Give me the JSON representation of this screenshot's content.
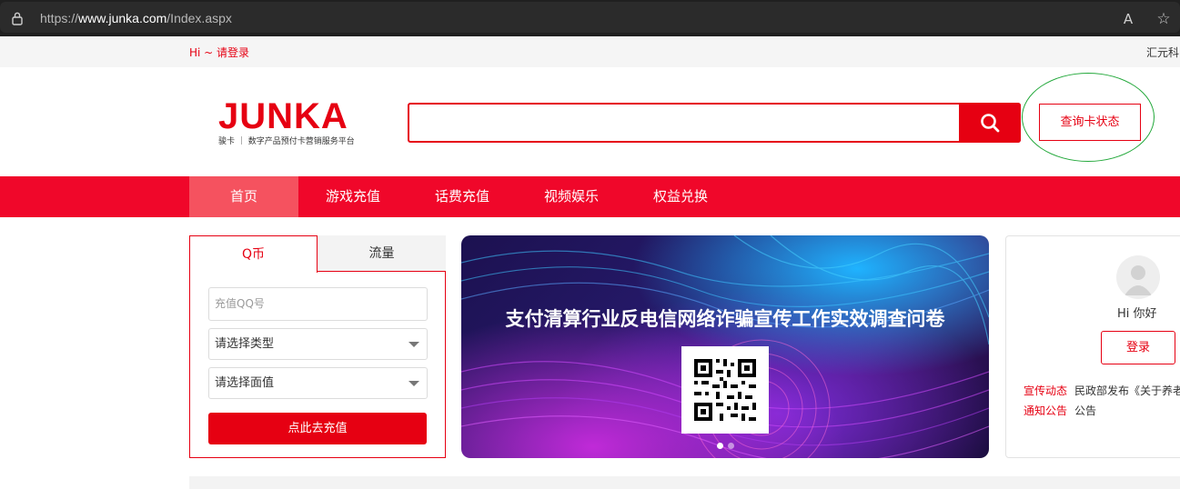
{
  "browser": {
    "url_prefix": "https://",
    "url_domain": "www.junka.com",
    "url_path": "/Index.aspx",
    "read_aloud_icon": "A",
    "favorite_icon": "☆"
  },
  "topbar": {
    "greeting": "Hi ~ 请登录",
    "right_text": "汇元科"
  },
  "header": {
    "logo_word": "JUNKA",
    "logo_tagline": "骏卡 ｜ 数字产品预付卡营销服务平台",
    "search_placeholder": "",
    "query_button": "查询卡状态"
  },
  "nav": {
    "items": [
      {
        "label": "首页"
      },
      {
        "label": "游戏充值"
      },
      {
        "label": "话费充值"
      },
      {
        "label": "视频娱乐"
      },
      {
        "label": "权益兑换"
      }
    ]
  },
  "recharge": {
    "tabs": [
      {
        "label": "Q币"
      },
      {
        "label": "流量"
      }
    ],
    "qq_placeholder": "充值QQ号",
    "type_select": "请选择类型",
    "value_select": "请选择面值",
    "submit": "点此去充值"
  },
  "banner": {
    "title": "支付清算行业反电信网络诈骗宣传工作实效调查问卷"
  },
  "user": {
    "hello": "Hi 你好",
    "login": "登录",
    "news": [
      {
        "tag": "宣传动态",
        "text": "民政部发布《关于养老"
      },
      {
        "tag": "通知公告",
        "text": "公告"
      }
    ]
  },
  "colors": {
    "brand_red": "#e60012",
    "nav_red": "#f0072a",
    "nav_active": "#f5525f",
    "ring_green": "#22a83a"
  }
}
